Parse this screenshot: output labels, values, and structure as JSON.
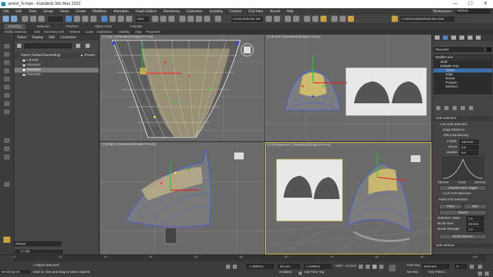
{
  "window": {
    "title": "armor_fv.max - Autodesk 3ds Max 2022",
    "minimize": "—",
    "maximize": "☐",
    "close": "✕"
  },
  "menu": [
    "File",
    "Edit",
    "Tools",
    "Group",
    "Views",
    "Create",
    "Modifiers",
    "Animation",
    "Graph Editors",
    "Rendering",
    "Customize",
    "Scripting",
    "Content",
    "Civil View",
    "Arnold",
    "Help"
  ],
  "workspace": {
    "label": "Workspaces:",
    "value": "Default"
  },
  "toolbar": {
    "view_dropdown": "View",
    "selection_set": "Create Selection Set",
    "path": "C:\\Users\\Autodesk\\3ds Max 2022"
  },
  "ribbon": {
    "tabs": [
      "Modeling",
      "Selection",
      "Freeform",
      "Object Paint",
      "Populate"
    ],
    "sub_items": [
      "Modify Selection",
      "Edit",
      "Geometry (All)",
      "Vertices",
      "Loops",
      "Subdivision",
      "Visibility",
      "Align",
      "Properties"
    ]
  },
  "scene_explorer": {
    "tabs": [
      "Select",
      "Display",
      "Edit",
      "Customize"
    ],
    "column_name": "Name (Sorted Ascending)",
    "column_frozen": "▲ Frozen",
    "items": [
      {
        "name": "Line002",
        "selected": false
      },
      {
        "name": "Inbox003",
        "selected": false
      },
      {
        "name": "Plane003",
        "selected": true
      },
      {
        "name": "Plane006",
        "selected": false
      }
    ]
  },
  "viewports": {
    "top": "[+] [Top ] [Standard] [Edged Faces]",
    "front": "[+] [Front ] [Standard] [Edged Faces]",
    "right": "[+] [Right ] [Standard] [Edged Faces]",
    "perspective": "[+] [Perspective ] [Standard] [Edged Faces]"
  },
  "modify_panel": {
    "object_name": "Plane003",
    "modifier_list": "Modifier List",
    "stack": [
      {
        "label": "Shell",
        "level": 0
      },
      {
        "label": "Editable Poly",
        "level": 0
      },
      {
        "label": "Vertex",
        "level": 1,
        "selected": true
      },
      {
        "label": "Edge",
        "level": 1
      },
      {
        "label": "Border",
        "level": 1
      },
      {
        "label": "Polygon",
        "level": 1
      },
      {
        "label": "Element",
        "level": 1
      }
    ],
    "soft_selection": {
      "title": "Soft Selection",
      "use_soft_selection": "Use Soft Selection",
      "edge_distance": "Edge Distance:",
      "affect_backfacing": "Affect Backfacing",
      "falloff_label": "Falloff:",
      "falloff_value": "100.0cm",
      "pinch_label": "Pinch:",
      "pinch_value": "0.0",
      "bubble_label": "Bubble:",
      "bubble_value": "0.0",
      "curve_left": "100.0cm",
      "curve_mid": "0.0cm",
      "curve_right": "100.0cm",
      "shaded_face_toggle": "Shaded Face Toggle",
      "lock_soft_selection": "Lock Soft Selection",
      "paint_soft_selection": "Paint Soft Selection",
      "paint": "Paint",
      "blur": "Blur",
      "revert": "Revert",
      "selection_value_label": "Selection Value",
      "selection_value": "1.0",
      "brush_size_label": "Brush Size",
      "brush_size": "20.0cm",
      "brush_strength_label": "Brush Strength",
      "brush_strength": "1.0",
      "brush_options": "Brush Options"
    },
    "edit_vertices": "Edit Vertices"
  },
  "layer": {
    "label": "Default"
  },
  "timeline": {
    "frame": "0 / 100",
    "ticks": [
      "0",
      "5",
      "10",
      "15",
      "20",
      "25",
      "30",
      "35",
      "40",
      "45",
      "50",
      "55",
      "60",
      "65",
      "70",
      "75",
      "80",
      "85",
      "90",
      "95",
      "100"
    ]
  },
  "status": {
    "objects_selected": "1 Object Selected",
    "prompt": "Click or click-and-drag to select objects",
    "maxscript": "MAXScript Mi",
    "x_value": "-1.9350cm",
    "y_value": "83.1cm",
    "z_value": "1.4399cm",
    "grid": "Grid = 10.0cm",
    "enabled": "Enabled:",
    "add_time_tag": "Add Time Tag",
    "auto_key": "Auto Key",
    "set_key": "Set Key",
    "selected": "Selected",
    "key_filters": "Key Filters...",
    "frame_field": "0"
  },
  "colors": {
    "accent": "#3d6fa6",
    "active_border": "#d8c84a",
    "viewport_bg": "#6b6b6b",
    "panel": "#444444"
  }
}
